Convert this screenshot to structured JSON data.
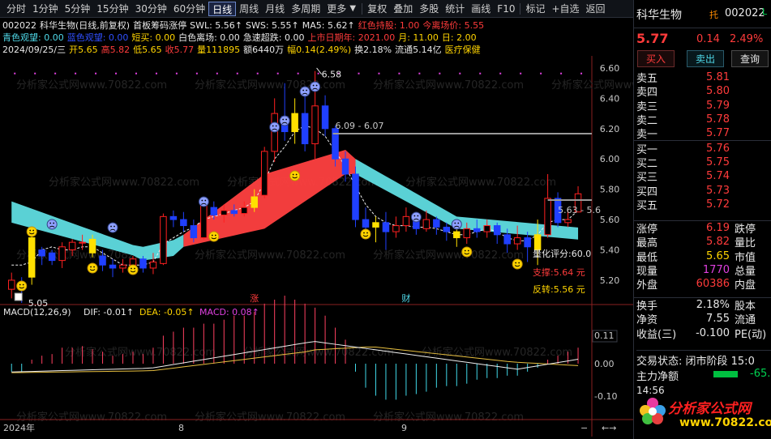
{
  "toolbar": {
    "items": [
      "分时",
      "1分钟",
      "5分钟",
      "15分钟",
      "30分钟",
      "60分钟",
      "日线",
      "周线",
      "月线",
      "多周期",
      "更多",
      "复权",
      "叠加",
      "多股",
      "统计",
      "画线",
      "F10",
      "标记",
      "+自选",
      "返回"
    ],
    "active_index": 6,
    "more_icon": "chevron-down-icon"
  },
  "header": {
    "line1": [
      {
        "t": "002022",
        "c": "w"
      },
      {
        "t": "科华生物(日线,前复权)",
        "c": "w"
      },
      {
        "t": "首板筹码涨停",
        "c": "w"
      },
      {
        "t": "SWL: 5.56↑",
        "c": "w"
      },
      {
        "t": "SWS: 5.55↑",
        "c": "w"
      },
      {
        "t": "MA5: 5.62↑",
        "c": "w"
      },
      {
        "t": "红色持股: 1.00",
        "c": "r"
      },
      {
        "t": "今离场价: 5.55",
        "c": "r"
      }
    ],
    "line2": [
      {
        "t": "青色观望: 0.00",
        "c": "c"
      },
      {
        "t": "蓝色观望: 0.00",
        "c": "b"
      },
      {
        "t": "短买: 0.00",
        "c": "y"
      },
      {
        "t": "白色离场: 0.00",
        "c": "w"
      },
      {
        "t": "急速超跌: 0.00",
        "c": "w"
      },
      {
        "t": "上市日期年: 2021.00",
        "c": "r"
      },
      {
        "t": "月: 11.00",
        "c": "y"
      },
      {
        "t": "日: 2.00",
        "c": "y"
      }
    ],
    "line3": [
      {
        "t": "2024/09/25/三",
        "c": "w"
      },
      {
        "t": "开5.65",
        "c": "y"
      },
      {
        "t": "高5.82",
        "c": "r"
      },
      {
        "t": "低5.65",
        "c": "y"
      },
      {
        "t": "收5.77",
        "c": "r"
      },
      {
        "t": "量111895",
        "c": "y"
      },
      {
        "t": "额6440万",
        "c": "w"
      },
      {
        "t": "幅0.14(2.49%)",
        "c": "y"
      },
      {
        "t": "换2.18%",
        "c": "w"
      },
      {
        "t": "流通5.14亿",
        "c": "w"
      },
      {
        "t": "医疗保健",
        "c": "y"
      }
    ]
  },
  "price_axis": [
    "6.60",
    "6.40",
    "6.20",
    "6.00",
    "5.80",
    "5.60",
    "5.40",
    "5.20"
  ],
  "chart_annotations": {
    "high": "6.58",
    "low": "5.05",
    "range_label": "6.09 - 6.07",
    "right_range": "5.63 - 5.6",
    "score": "量化评分:60.0",
    "support": "支撑:5.64 元",
    "reversal": "反转:5.56 元",
    "mark_up": "涨",
    "mark_fin": "财",
    "watermark": "分析家公式网www.70822.com"
  },
  "macd": {
    "title": "MACD(12,26,9)",
    "dif": "DIF: -0.01↑",
    "dea": "DEA: -0.05↑",
    "macd": "MACD: 0.08↑",
    "axis": [
      "0.11",
      "0.00",
      "-0.10"
    ]
  },
  "time_axis": {
    "labels": [
      "2024年",
      "8",
      "9"
    ],
    "nav": [
      "−",
      "←→"
    ]
  },
  "right_panel": {
    "name": "科华生物",
    "tag": "托",
    "code": "002022",
    "corner": "L",
    "price": "5.77",
    "change": "0.14",
    "pct": "2.49%",
    "buttons": [
      "买入",
      "卖出",
      "查询"
    ],
    "asks": [
      [
        "卖五",
        "5.81"
      ],
      [
        "卖四",
        "5.80"
      ],
      [
        "卖三",
        "5.79"
      ],
      [
        "卖二",
        "5.78"
      ],
      [
        "卖一",
        "5.77"
      ]
    ],
    "bids": [
      [
        "买一",
        "5.76"
      ],
      [
        "买二",
        "5.75"
      ],
      [
        "买三",
        "5.74"
      ],
      [
        "买四",
        "5.73"
      ],
      [
        "买五",
        "5.72"
      ]
    ],
    "stats": [
      [
        "涨停",
        "6.19",
        "跌停"
      ],
      [
        "最高",
        "5.82",
        "量比"
      ],
      [
        "最低",
        "5.65",
        "市值"
      ],
      [
        "现量",
        "1770",
        "总量"
      ],
      [
        "外盘",
        "60386",
        "内盘"
      ]
    ],
    "stats2": [
      [
        "换手",
        "2.18%",
        "股本"
      ],
      [
        "净资",
        "7.55",
        "流通"
      ],
      [
        "收益(三)",
        "-0.100",
        "PE(动)"
      ]
    ],
    "status": "交易状态: 闭市阶段 15:0",
    "net_label": "主力净额",
    "net_val": "-65.",
    "time": "14:56",
    "logo_text": "分析家公式网",
    "logo_url": "www.70822.com"
  }
}
